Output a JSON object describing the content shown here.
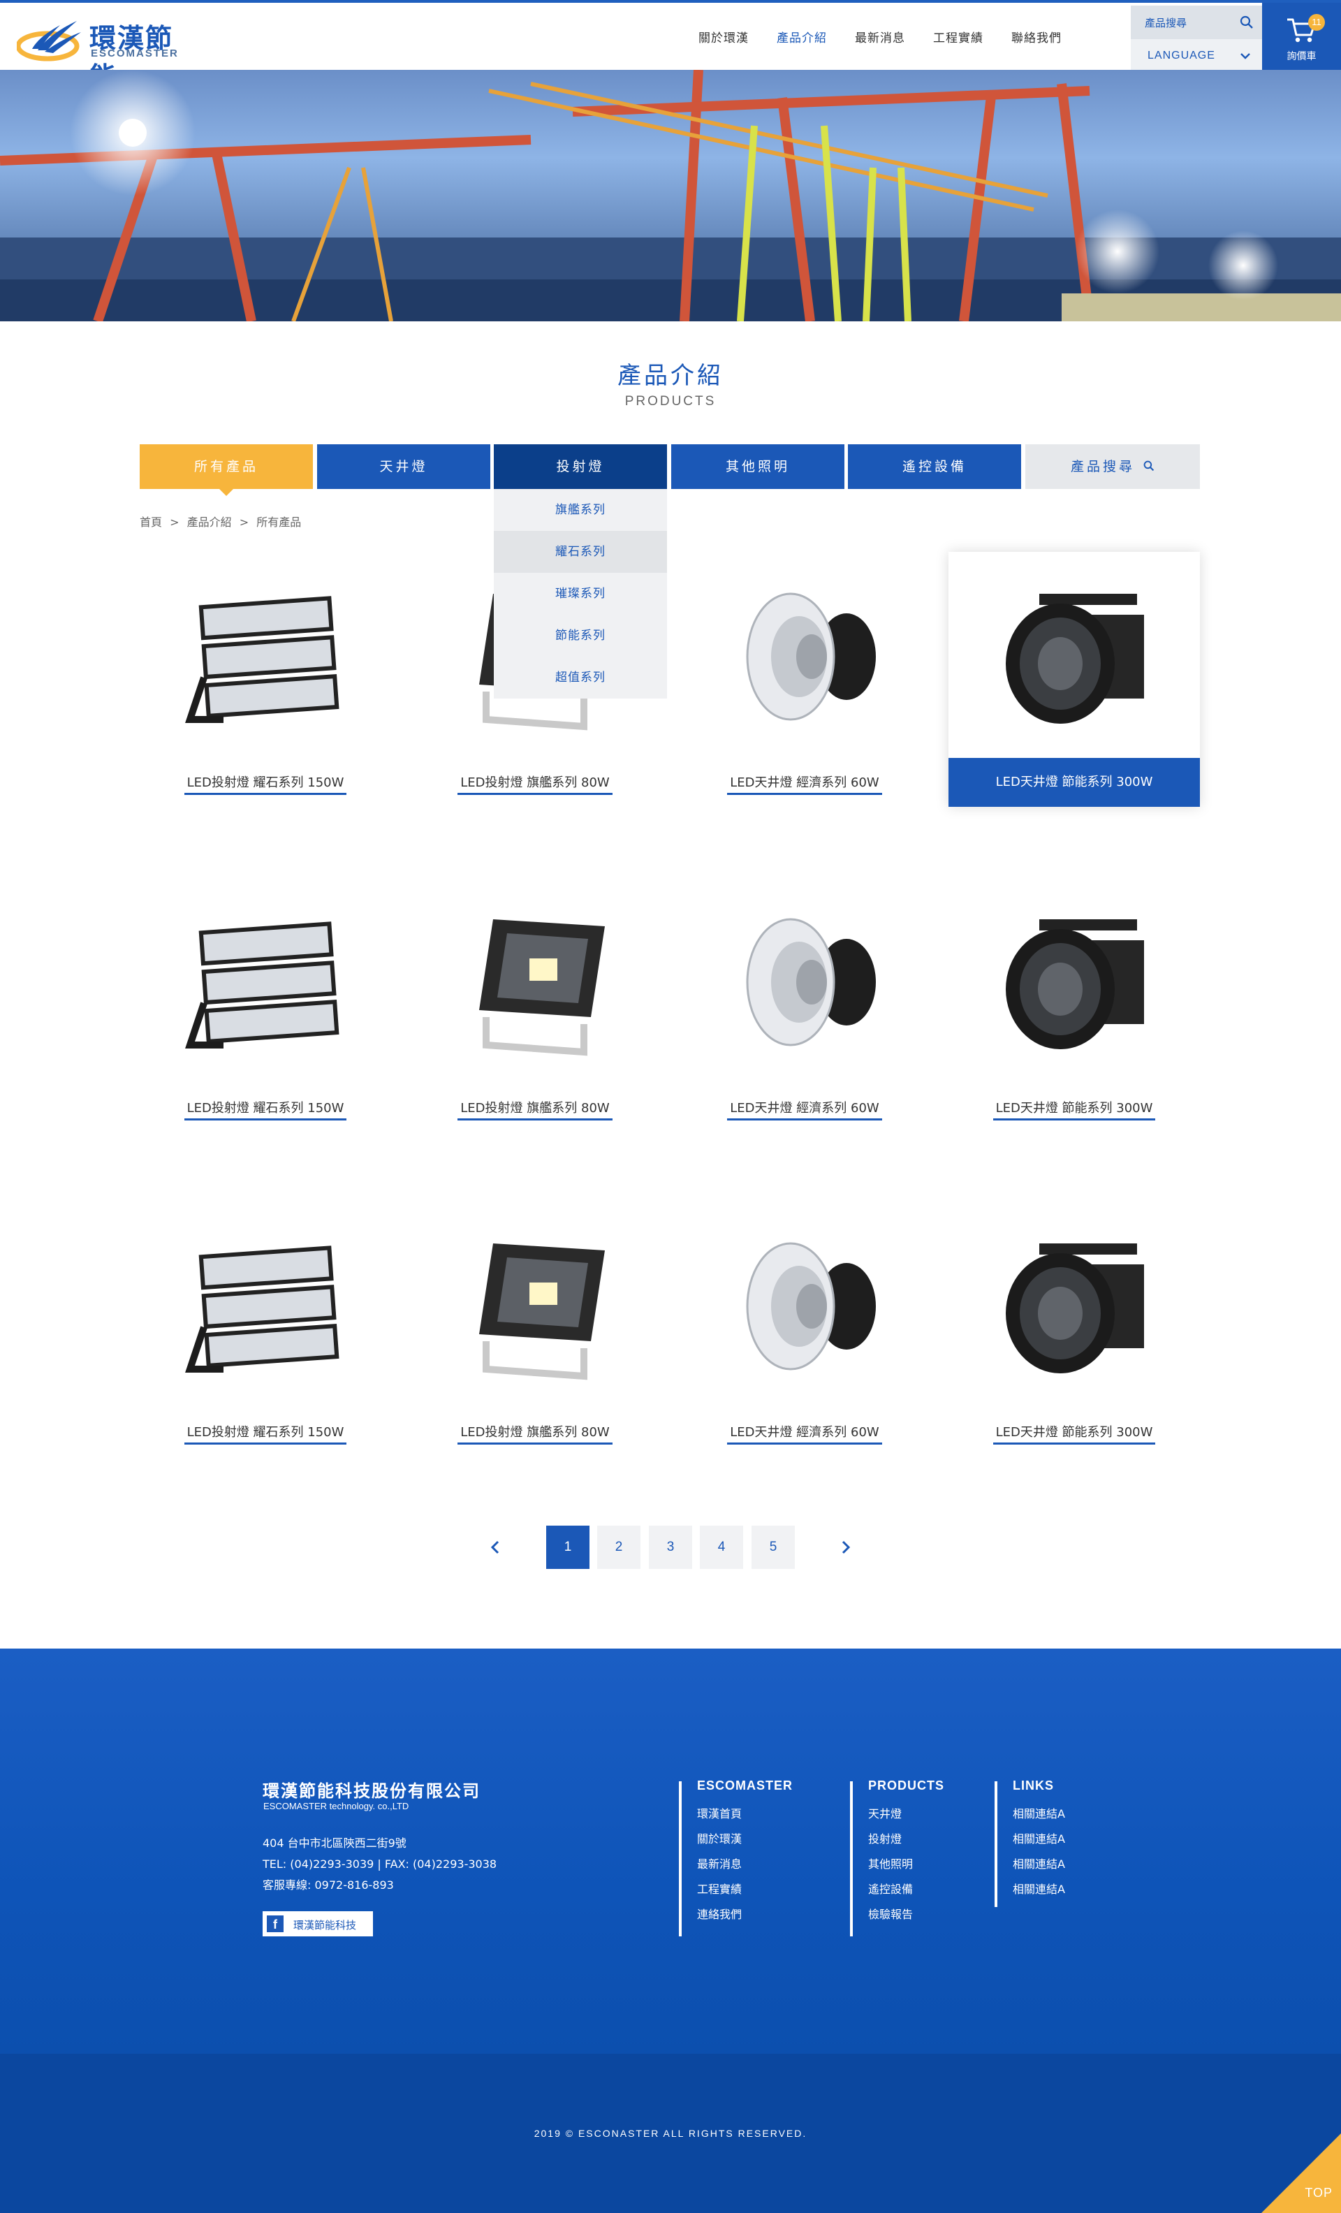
{
  "header": {
    "logo_cn": "環漢節能",
    "logo_en": "ESCOMASTER",
    "nav": [
      "關於環漢",
      "產品介紹",
      "最新消息",
      "工程實績",
      "聯絡我們"
    ],
    "search_label": "產品搜尋",
    "language_label": "LANGUAGE",
    "cart_label": "詢價車",
    "cart_count": "11"
  },
  "section": {
    "title": "產品介紹",
    "subtitle": "PRODUCTS"
  },
  "tabs": [
    "所有產品",
    "天井燈",
    "投射燈",
    "其他照明",
    "遙控設備",
    "產品搜尋"
  ],
  "dropdown": [
    "旗艦系列",
    "耀石系列",
    "璀璨系列",
    "節能系列",
    "超值系列"
  ],
  "breadcrumb": [
    "首頁",
    ">",
    "產品介紹",
    ">",
    "所有產品"
  ],
  "products": [
    {
      "name": "LED投射燈 耀石系列 150W",
      "icon": "flood-module-light"
    },
    {
      "name": "LED投射燈 旗艦系列 80W",
      "icon": "flood-panel-light"
    },
    {
      "name": "LED天井燈 經濟系列 60W",
      "icon": "highbay-reflector-light"
    },
    {
      "name": "LED天井燈 節能系列 300W",
      "icon": "highbay-industrial-light"
    },
    {
      "name": "LED投射燈 耀石系列 150W",
      "icon": "flood-module-light"
    },
    {
      "name": "LED投射燈 旗艦系列 80W",
      "icon": "flood-panel-light"
    },
    {
      "name": "LED天井燈 經濟系列 60W",
      "icon": "highbay-reflector-light"
    },
    {
      "name": "LED天井燈 節能系列 300W",
      "icon": "highbay-industrial-light"
    },
    {
      "name": "LED投射燈 耀石系列 150W",
      "icon": "flood-module-light"
    },
    {
      "name": "LED投射燈 旗艦系列 80W",
      "icon": "flood-panel-light"
    },
    {
      "name": "LED天井燈 經濟系列 60W",
      "icon": "highbay-reflector-light"
    },
    {
      "name": "LED天井燈 節能系列 300W",
      "icon": "highbay-industrial-light"
    }
  ],
  "pagination": {
    "pages": [
      "1",
      "2",
      "3",
      "4",
      "5"
    ],
    "current": "1"
  },
  "footer": {
    "company": "環漢節能科技股份有限公司",
    "company_en": "ESCOMASTER technology. co.,LTD",
    "address": "404 台中市北區陝西二街9號",
    "tel_fax": "TEL: (04)2293-3039   |  FAX: (04)2293-3038",
    "hotline": "客服專線: 0972-816-893",
    "facebook_label": "環漢節能科技",
    "columns": [
      {
        "title": "ESCOMASTER",
        "items": [
          "環漢首頁",
          "關於環漢",
          "最新消息",
          "工程實績",
          "連絡我們"
        ]
      },
      {
        "title": "PRODUCTS",
        "items": [
          "天井燈",
          "投射燈",
          "其他照明",
          "遙控設備",
          "檢驗報告"
        ]
      },
      {
        "title": "LINKS",
        "items": [
          "相關連結A",
          "相關連結A",
          "相關連結A",
          "相關連結A"
        ]
      }
    ],
    "copyright": "2019 © ESCONASTER ALL RIGHTS RESERVED.",
    "top_label": "TOP"
  },
  "colors": {
    "brand_blue": "#1b58b7",
    "accent_yellow": "#f7b53c",
    "footer_blue": "#0c4fae"
  }
}
